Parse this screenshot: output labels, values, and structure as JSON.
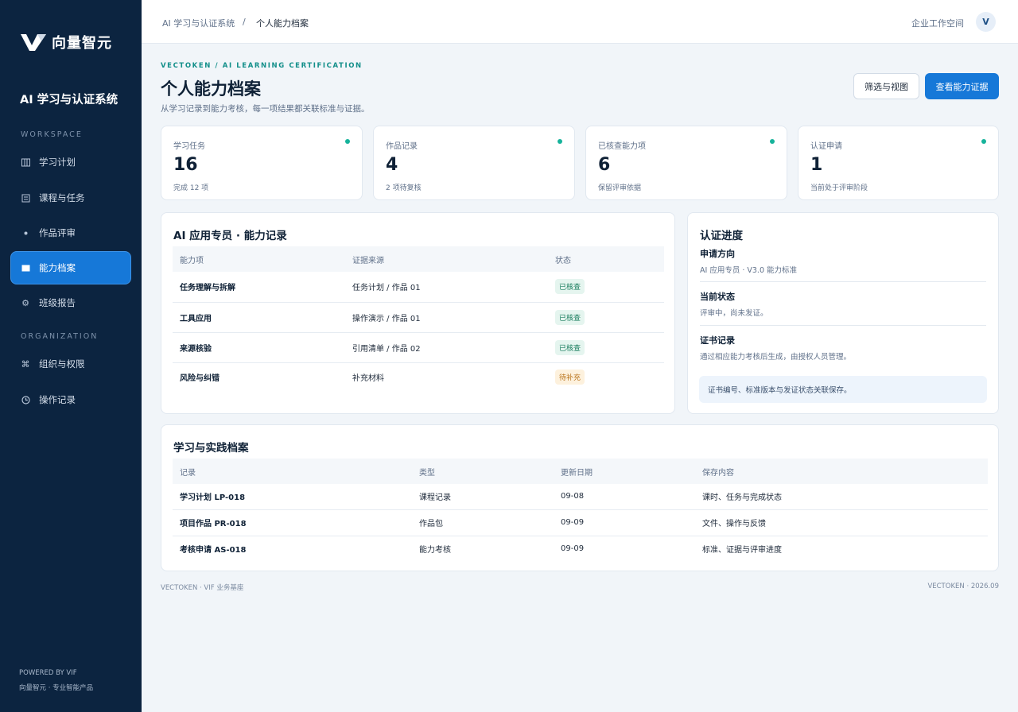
{
  "brand": {
    "name": "向量智元"
  },
  "sidebar": {
    "system_title": "AI 学习与认证系统",
    "section_workspace": "WORKSPACE",
    "section_organization": "ORGANIZATION",
    "items": [
      {
        "label": "学习计划",
        "icon": "columns-icon"
      },
      {
        "label": "课程与任务",
        "icon": "list-icon"
      },
      {
        "label": "作品评审",
        "icon": "dot-icon"
      },
      {
        "label": "能力档案",
        "icon": "card-icon",
        "active": true
      },
      {
        "label": "班级报告",
        "icon": "gear-icon"
      },
      {
        "label": "组织与权限",
        "icon": "command-icon"
      },
      {
        "label": "操作记录",
        "icon": "clock-icon"
      }
    ],
    "powered_by": "POWERED BY VIF",
    "powered_sub": "向量智元 · 专业智能产品"
  },
  "topbar": {
    "breadcrumb_root": "AI 学习与认证系统",
    "breadcrumb_sep": "/",
    "breadcrumb_current": "个人能力档案",
    "workspace_link": "企业工作空间",
    "avatar_initial": "V"
  },
  "header": {
    "eyebrow": "VECTOKEN / AI LEARNING CERTIFICATION",
    "title": "个人能力档案",
    "subtitle": "从学习记录到能力考核，每一项结果都关联标准与证据。",
    "filter_button": "筛选与视图",
    "primary_button": "查看能力证据"
  },
  "stats": [
    {
      "label": "学习任务",
      "value": "16",
      "note": "完成 12 项"
    },
    {
      "label": "作品记录",
      "value": "4",
      "note": "2 项待复核"
    },
    {
      "label": "已核查能力项",
      "value": "6",
      "note": "保留评审依据"
    },
    {
      "label": "认证申请",
      "value": "1",
      "note": "当前处于评审阶段"
    }
  ],
  "ability": {
    "title": "AI 应用专员 · 能力记录",
    "columns": [
      "能力项",
      "证据来源",
      "状态"
    ],
    "rows": [
      {
        "item": "任务理解与拆解",
        "source": "任务计划 / 作品 01",
        "status": "已核查",
        "tone": "ok"
      },
      {
        "item": "工具应用",
        "source": "操作演示 / 作品 01",
        "status": "已核查",
        "tone": "ok"
      },
      {
        "item": "来源核验",
        "source": "引用清单 / 作品 02",
        "status": "已核查",
        "tone": "ok"
      },
      {
        "item": "风险与纠错",
        "source": "补充材料",
        "status": "待补充",
        "tone": "warn"
      }
    ]
  },
  "progress": {
    "title": "认证进度",
    "direction_label": "申请方向",
    "direction_value": "AI 应用专员 · V3.0 能力标准",
    "status_label": "当前状态",
    "status_value": "评审中，尚未发证。",
    "cert_label": "证书记录",
    "cert_value": "通过相应能力考核后生成，由授权人员管理。",
    "note": "证书编号、标准版本与发证状态关联保存。"
  },
  "archive": {
    "title": "学习与实践档案",
    "columns": [
      "记录",
      "类型",
      "更新日期",
      "保存内容"
    ],
    "rows": [
      {
        "record": "学习计划 LP-018",
        "type": "课程记录",
        "date": "09-08",
        "content": "课时、任务与完成状态"
      },
      {
        "record": "项目作品 PR-018",
        "type": "作品包",
        "date": "09-09",
        "content": "文件、操作与反馈"
      },
      {
        "record": "考核申请 AS-018",
        "type": "能力考核",
        "date": "09-09",
        "content": "标准、证据与评审进度"
      }
    ]
  },
  "footer": {
    "left": "VECTOKEN  ·  VIF 业务基座",
    "right": "VECTOKEN  ·  2026.09"
  },
  "colors": {
    "sidebar": "#0c2440",
    "accent": "#1678d8",
    "eyebrow": "#138f8a",
    "status_dot": "#16b39b"
  }
}
